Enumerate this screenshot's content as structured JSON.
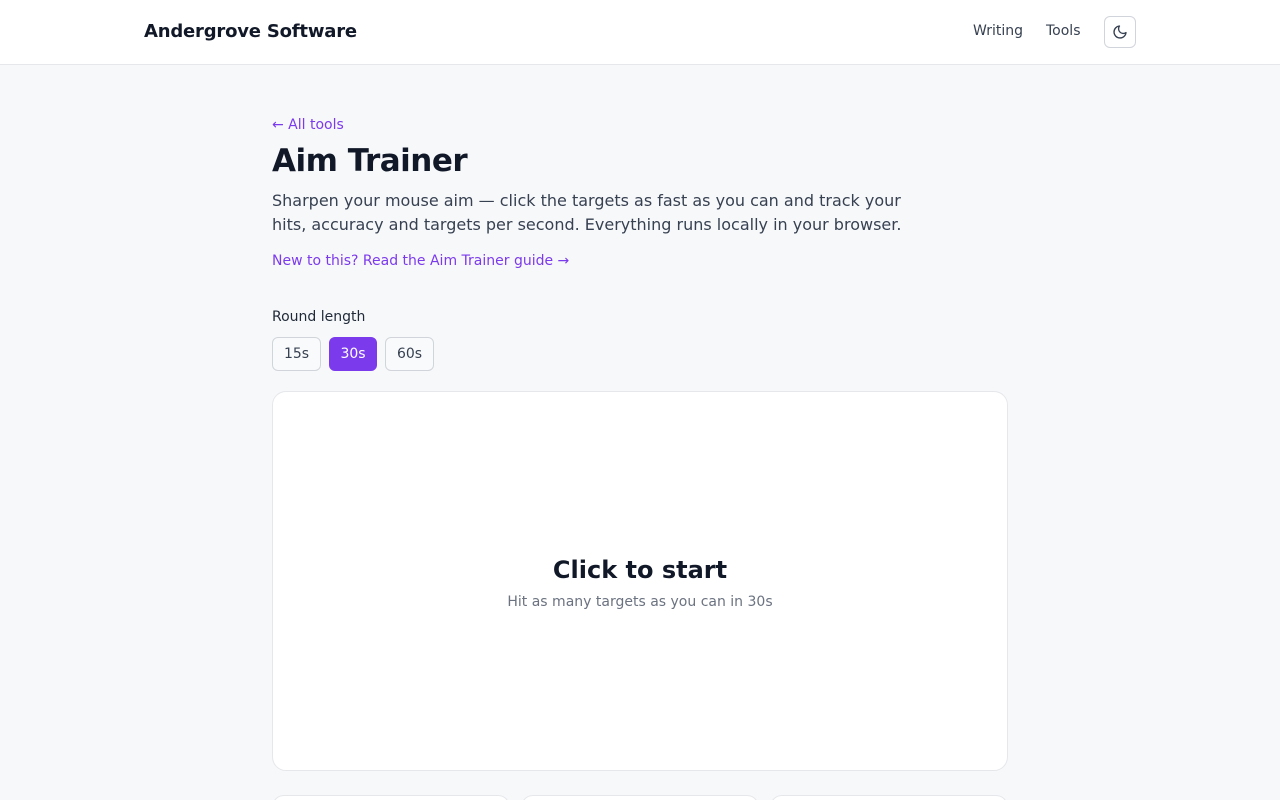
{
  "header": {
    "brand": "Andergrove Software",
    "nav": [
      {
        "label": "Writing"
      },
      {
        "label": "Tools"
      }
    ],
    "theme_toggle_icon": "moon-icon"
  },
  "main": {
    "back_link": "← All tools",
    "title": "Aim Trainer",
    "intro": "Sharpen your mouse aim — click the targets as fast as you can and track your hits, accuracy and targets per second. Everything runs locally in your browser.",
    "guide_link": "New to this? Read the Aim Trainer guide →",
    "round_length": {
      "label": "Round length",
      "options": [
        "15s",
        "30s",
        "60s"
      ],
      "selected": "30s"
    },
    "arena": {
      "title": "Click to start",
      "subtitle": "Hit as many targets as you can in 30s"
    }
  },
  "colors": {
    "accent": "#7c3aed",
    "background": "#f7f8fa",
    "text": "#111827"
  }
}
